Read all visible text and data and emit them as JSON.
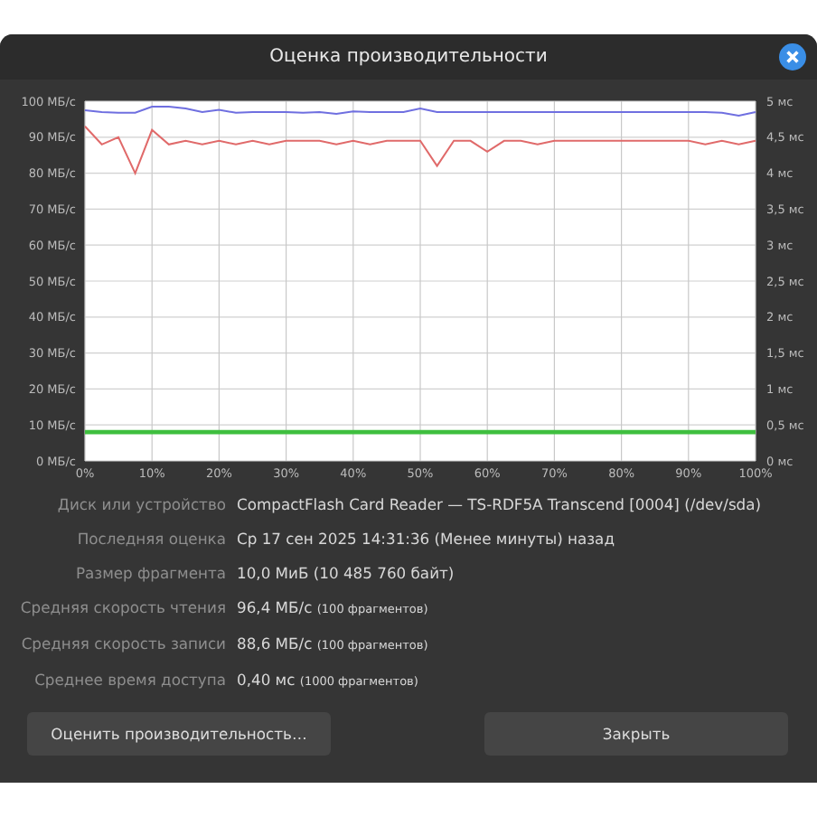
{
  "window": {
    "title": "Оценка производительности"
  },
  "chart": {
    "chart_data": {
      "type": "line",
      "x": [
        0,
        2.5,
        5,
        7.5,
        10,
        12.5,
        15,
        17.5,
        20,
        22.5,
        25,
        27.5,
        30,
        32.5,
        35,
        37.5,
        40,
        42.5,
        45,
        47.5,
        50,
        52.5,
        55,
        57.5,
        60,
        62.5,
        65,
        67.5,
        70,
        72.5,
        75,
        77.5,
        80,
        82.5,
        85,
        87.5,
        90,
        92.5,
        95,
        97.5,
        100
      ],
      "grid": true,
      "xlim": [
        0,
        100
      ],
      "ylim": [
        0,
        100
      ],
      "xticks": [
        {
          "value": 0,
          "label": "0%"
        },
        {
          "value": 10,
          "label": "10%"
        },
        {
          "value": 20,
          "label": "20%"
        },
        {
          "value": 30,
          "label": "30%"
        },
        {
          "value": 40,
          "label": "40%"
        },
        {
          "value": 50,
          "label": "50%"
        },
        {
          "value": 60,
          "label": "60%"
        },
        {
          "value": 70,
          "label": "70%"
        },
        {
          "value": 80,
          "label": "80%"
        },
        {
          "value": 90,
          "label": "90%"
        },
        {
          "value": 100,
          "label": "100%"
        }
      ],
      "yticks": [
        {
          "value": 0,
          "label": "0 МБ/с"
        },
        {
          "value": 10,
          "label": "10 МБ/с"
        },
        {
          "value": 20,
          "label": "20 МБ/с"
        },
        {
          "value": 30,
          "label": "30 МБ/с"
        },
        {
          "value": 40,
          "label": "40 МБ/с"
        },
        {
          "value": 50,
          "label": "50 МБ/с"
        },
        {
          "value": 60,
          "label": "60 МБ/с"
        },
        {
          "value": 70,
          "label": "70 МБ/с"
        },
        {
          "value": 80,
          "label": "80 МБ/с"
        },
        {
          "value": 90,
          "label": "90 МБ/с"
        },
        {
          "value": 100,
          "label": "100 МБ/с"
        }
      ],
      "y2lim": [
        0,
        5
      ],
      "y2ticks": [
        {
          "value": 0,
          "label": "0 мс"
        },
        {
          "value": 0.5,
          "label": "0,5 мс"
        },
        {
          "value": 1,
          "label": "1 мс"
        },
        {
          "value": 1.5,
          "label": "1,5 мс"
        },
        {
          "value": 2,
          "label": "2 мс"
        },
        {
          "value": 2.5,
          "label": "2,5 мс"
        },
        {
          "value": 3,
          "label": "3 мс"
        },
        {
          "value": 3.5,
          "label": "3,5 мс"
        },
        {
          "value": 4,
          "label": "4 мс"
        },
        {
          "value": 4.5,
          "label": "4,5 мс"
        },
        {
          "value": 5,
          "label": "5 мс"
        }
      ],
      "series": [
        {
          "color": "#6f6fe0",
          "values": [
            97.5,
            97,
            96.8,
            96.8,
            98.5,
            98.5,
            98,
            97,
            97.6,
            96.8,
            97,
            97,
            97,
            96.8,
            97,
            96.5,
            97.2,
            97,
            97,
            97,
            98,
            97,
            97,
            97,
            97,
            97,
            97,
            97,
            97,
            97,
            97,
            97,
            97,
            97,
            97,
            97,
            97,
            97,
            96.8,
            96,
            97
          ]
        },
        {
          "color": "#e06a6a",
          "values": [
            93,
            88,
            90,
            80,
            92,
            88,
            89,
            88,
            89,
            88,
            89,
            88,
            89,
            89,
            89,
            88,
            89,
            88,
            89,
            89,
            89,
            82,
            89,
            89,
            86,
            89,
            89,
            88,
            89,
            89,
            89,
            89,
            89,
            89,
            89,
            89,
            89,
            88,
            89,
            88,
            89
          ]
        },
        {
          "color": "#3fbf3f",
          "axis": "y2",
          "values": [
            0.4,
            0.4,
            0.4,
            0.4,
            0.4,
            0.4,
            0.4,
            0.4,
            0.4,
            0.4,
            0.4,
            0.4,
            0.4,
            0.4,
            0.4,
            0.4,
            0.4,
            0.4,
            0.4,
            0.4,
            0.4,
            0.4,
            0.4,
            0.4,
            0.4,
            0.4,
            0.4,
            0.4,
            0.4,
            0.4,
            0.4,
            0.4,
            0.4,
            0.4,
            0.4,
            0.4,
            0.4,
            0.4,
            0.4,
            0.4,
            0.4
          ]
        }
      ]
    }
  },
  "info": [
    {
      "label": "Диск или устройство",
      "value": "CompactFlash Card Reader — TS-RDF5A Transcend [0004] (/dev/sda)"
    },
    {
      "label": "Последняя оценка",
      "value": "Ср 17 сен 2025 14:31:36 (Менее минуты) назад"
    },
    {
      "label": "Размер фрагмента",
      "value": "10,0 МиБ (10 485 760 байт)"
    },
    {
      "label": "Средняя скорость чтения",
      "value": "96,4 МБ/с",
      "note": "(100 фрагментов)"
    },
    {
      "label": "Средняя скорость записи",
      "value": "88,6 МБ/с",
      "note": "(100 фрагментов)"
    },
    {
      "label": "Среднее время доступа",
      "value": "0,40 мс",
      "note": "(1000 фрагментов)"
    }
  ],
  "buttons": [
    {
      "label": "Оценить производительность…"
    },
    {
      "label": "Закрыть"
    }
  ]
}
